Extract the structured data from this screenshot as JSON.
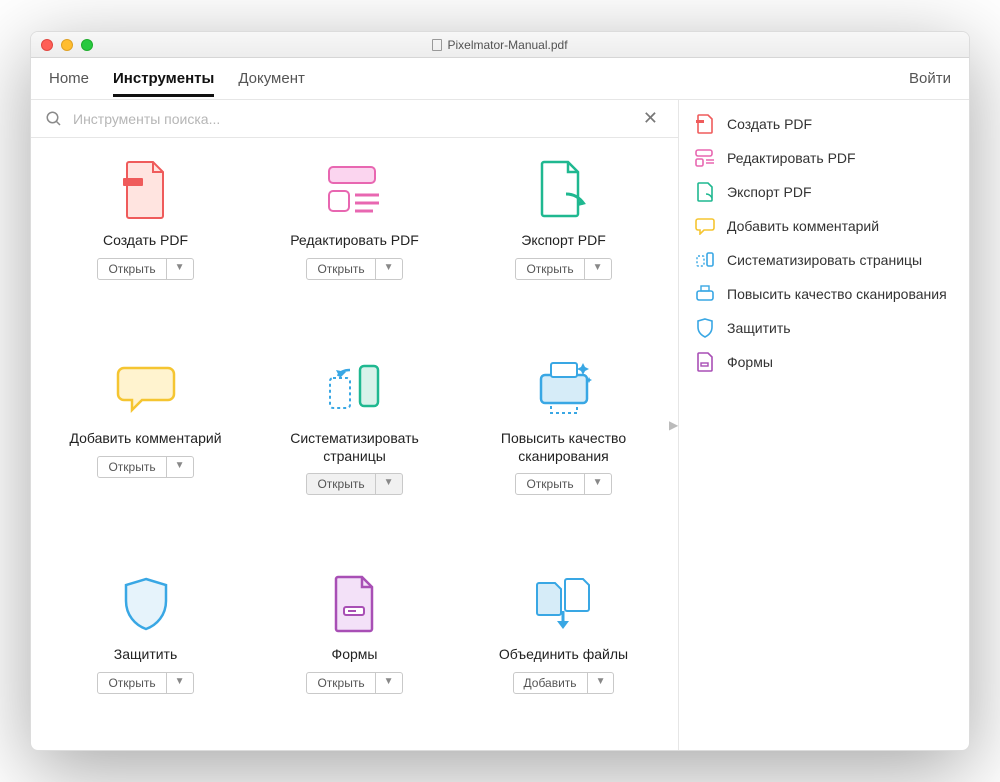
{
  "window": {
    "title": "Pixelmator-Manual.pdf"
  },
  "nav": {
    "home": "Home",
    "tools": "Инструменты",
    "document": "Документ",
    "login": "Войти"
  },
  "search": {
    "placeholder": "Инструменты поиска..."
  },
  "buttons": {
    "open": "Открыть",
    "add": "Добавить"
  },
  "cards": {
    "create_pdf": "Создать PDF",
    "edit_pdf": "Редактировать PDF",
    "export_pdf": "Экспорт PDF",
    "add_comment": "Добавить комментарий",
    "organize_pages": "Систематизировать страницы",
    "enhance_scan": "Повысить качество сканирования",
    "protect": "Защитить",
    "forms": "Формы",
    "combine": "Объединить файлы"
  },
  "sidebar": {
    "create_pdf": "Создать PDF",
    "edit_pdf": "Редактировать PDF",
    "export_pdf": "Экспорт PDF",
    "add_comment": "Добавить комментарий",
    "organize_pages": "Систематизировать страницы",
    "enhance_scan": "Повысить качество сканирования",
    "protect": "Защитить",
    "forms": "Формы"
  },
  "colors": {
    "red": "#ef5b5b",
    "pink": "#e867b1",
    "green": "#1fb890",
    "yellow": "#f5c531",
    "blue": "#39a7e4",
    "purple": "#a84fb5"
  }
}
